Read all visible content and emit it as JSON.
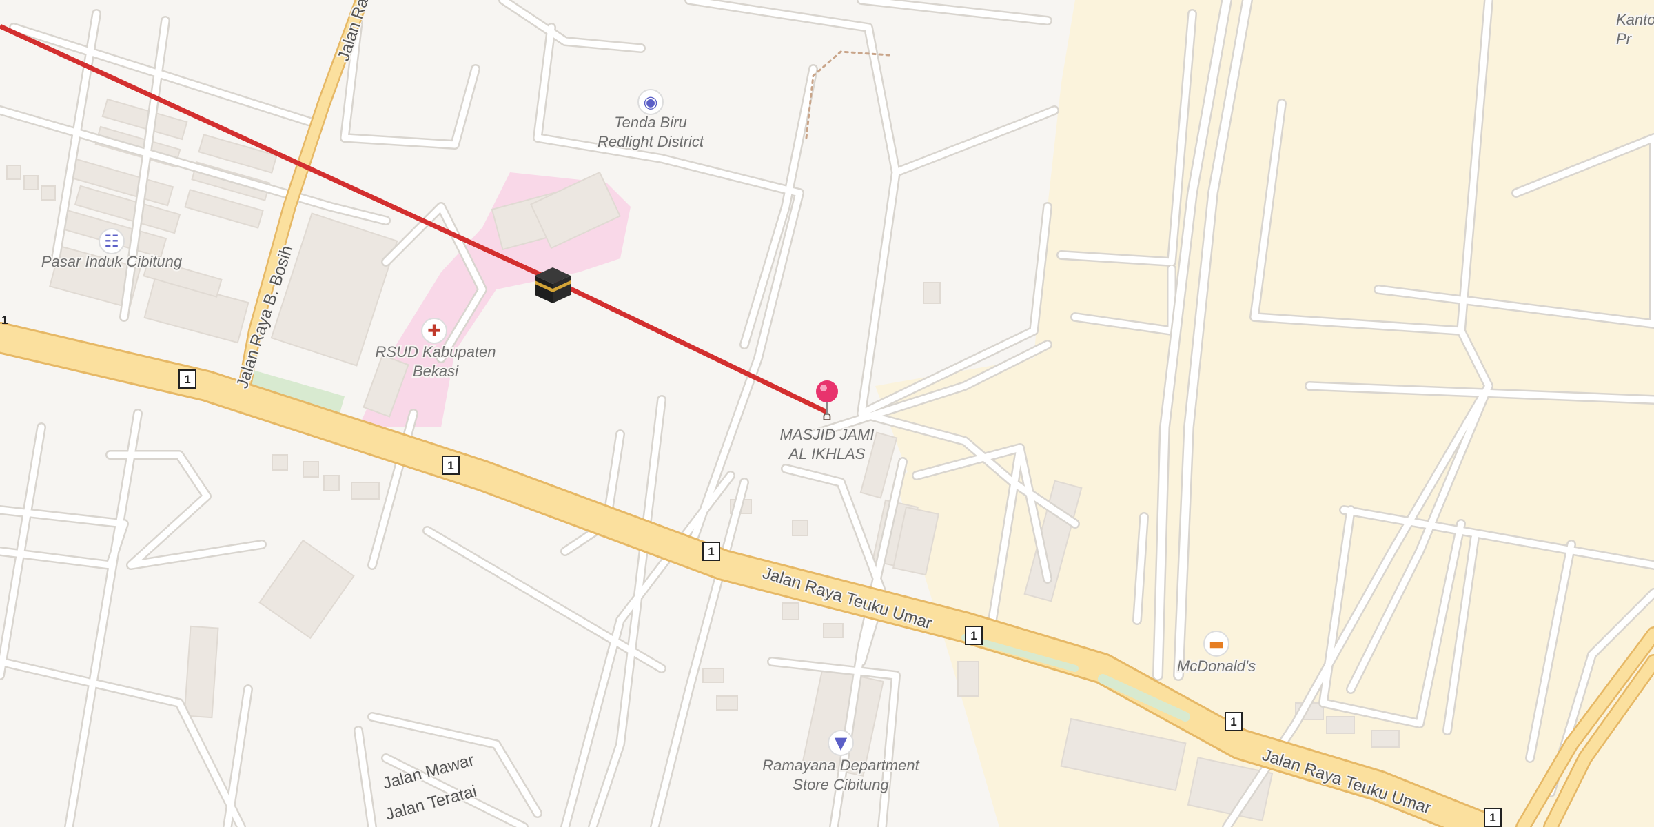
{
  "map": {
    "pois": [
      {
        "name": "Tenda Biru\nRedlight District",
        "icon": "camera-icon",
        "color": "#5b5fc7"
      },
      {
        "name": "Pasar Induk Cibitung",
        "icon": "shopping-cart-icon",
        "color": "#5b5fc7"
      },
      {
        "name": "RSUD Kabupaten\nBekasi",
        "icon": "hospital-cross-icon",
        "color": "#c0392b"
      },
      {
        "name": "MASJID JAMI\nAL IKHLAS",
        "icon": "mosque-icon",
        "color": "#6b5a4e"
      },
      {
        "name": "McDonald's",
        "icon": "burger-icon",
        "color": "#e67e22"
      },
      {
        "name": "Ramayana Department\nStore Cibitung",
        "icon": "shirt-icon",
        "color": "#5b5fc7"
      }
    ],
    "streets": [
      "Jalan Raya Teuku Umar",
      "Jalan Raya Teuku Umar",
      "Jalan Raya B. Bosih",
      "Jalan Ra",
      "Jalan Mawar",
      "Jalan Teratai"
    ],
    "route_shields": [
      "1",
      "1",
      "1",
      "1",
      "1",
      "1",
      "1"
    ],
    "edge_labels": {
      "top_right": "Kanto\nPr",
      "left_fragment": "1"
    },
    "pin": {
      "color": "#e8336d",
      "icon": "location-pin-icon"
    },
    "kaaba": {
      "icon": "kaaba-icon"
    },
    "qibla_line": {
      "color": "#d32f2f"
    },
    "colors": {
      "background": "#f7f5f2",
      "major_road": "#fbe09e",
      "major_road_casing": "#e6b866",
      "minor_road": "#ffffff",
      "minor_road_casing": "#d9d5cf",
      "building": "#ece7e1",
      "industrial": "#fbf3dc",
      "hospital_area": "#f9d8e8",
      "park": "#d8ead0"
    }
  }
}
